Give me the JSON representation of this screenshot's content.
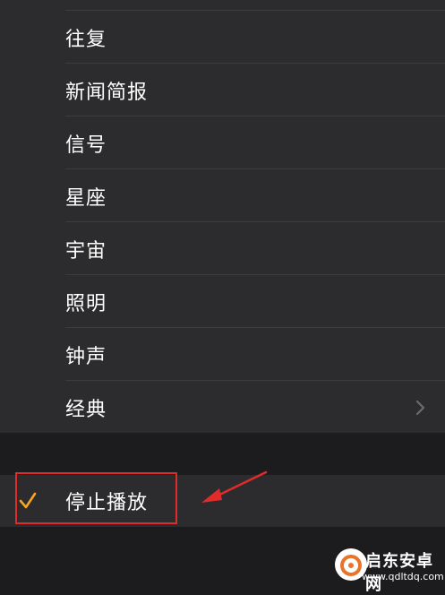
{
  "menu": {
    "items": [
      {
        "label": "往复",
        "has_chevron": false
      },
      {
        "label": "新闻简报",
        "has_chevron": false
      },
      {
        "label": "信号",
        "has_chevron": false
      },
      {
        "label": "星座",
        "has_chevron": false
      },
      {
        "label": "宇宙",
        "has_chevron": false
      },
      {
        "label": "照明",
        "has_chevron": false
      },
      {
        "label": "钟声",
        "has_chevron": false
      },
      {
        "label": "经典",
        "has_chevron": true
      }
    ]
  },
  "stop": {
    "label": "停止播放",
    "checked": true
  },
  "watermark": {
    "title": "启东安卓网",
    "url": "www.qdltdq.com"
  },
  "colors": {
    "background": "#1c1c1e",
    "list_background": "#2c2c2e",
    "separator": "#3d3d40",
    "text": "#ffffff",
    "check": "#f5a623",
    "annotation": "#e02b2b"
  }
}
